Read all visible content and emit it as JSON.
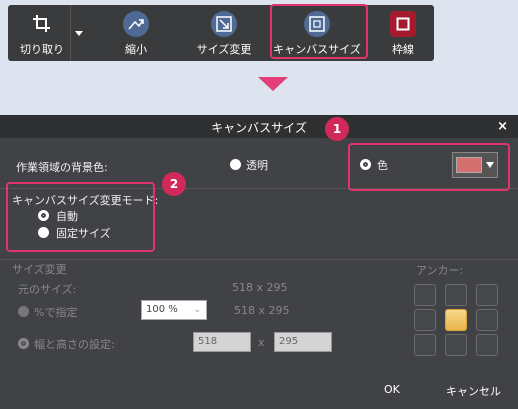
{
  "toolbar": {
    "tools": [
      {
        "label": "切り取り",
        "icon": "crop-icon"
      },
      {
        "label": "縮小",
        "icon": "shrink-icon"
      },
      {
        "label": "サイズ変更",
        "icon": "resize-icon"
      },
      {
        "label": "キャンバスサイズ",
        "icon": "canvas-size-icon"
      },
      {
        "label": "枠線",
        "icon": "border-icon"
      }
    ],
    "dropdown_icon": "chevron-down-icon"
  },
  "dialog": {
    "title": "キャンバスサイズ",
    "close": "×",
    "bg_label": "作業領域の背景色:",
    "transparent_label": "透明",
    "color_label": "色",
    "color_value": "#d47070",
    "mode_label": "キャンバスサイズ変更モード:",
    "mode_auto": "自動",
    "mode_fixed": "固定サイズ",
    "resize_section": "サイズ変更",
    "original_size_label": "元のサイズ:",
    "original_size_value": "518 x 295",
    "percent_label": "%で指定",
    "percent_value": "100 %",
    "percent_result": "518 x 295",
    "wh_label": "幅と高さの設定:",
    "width_value": "518",
    "times": "x",
    "height_value": "295",
    "anchor_label": "アンカー:",
    "ok": "OK",
    "cancel": "キャンセル"
  },
  "annotations": {
    "num1": "1",
    "num2": "2"
  }
}
